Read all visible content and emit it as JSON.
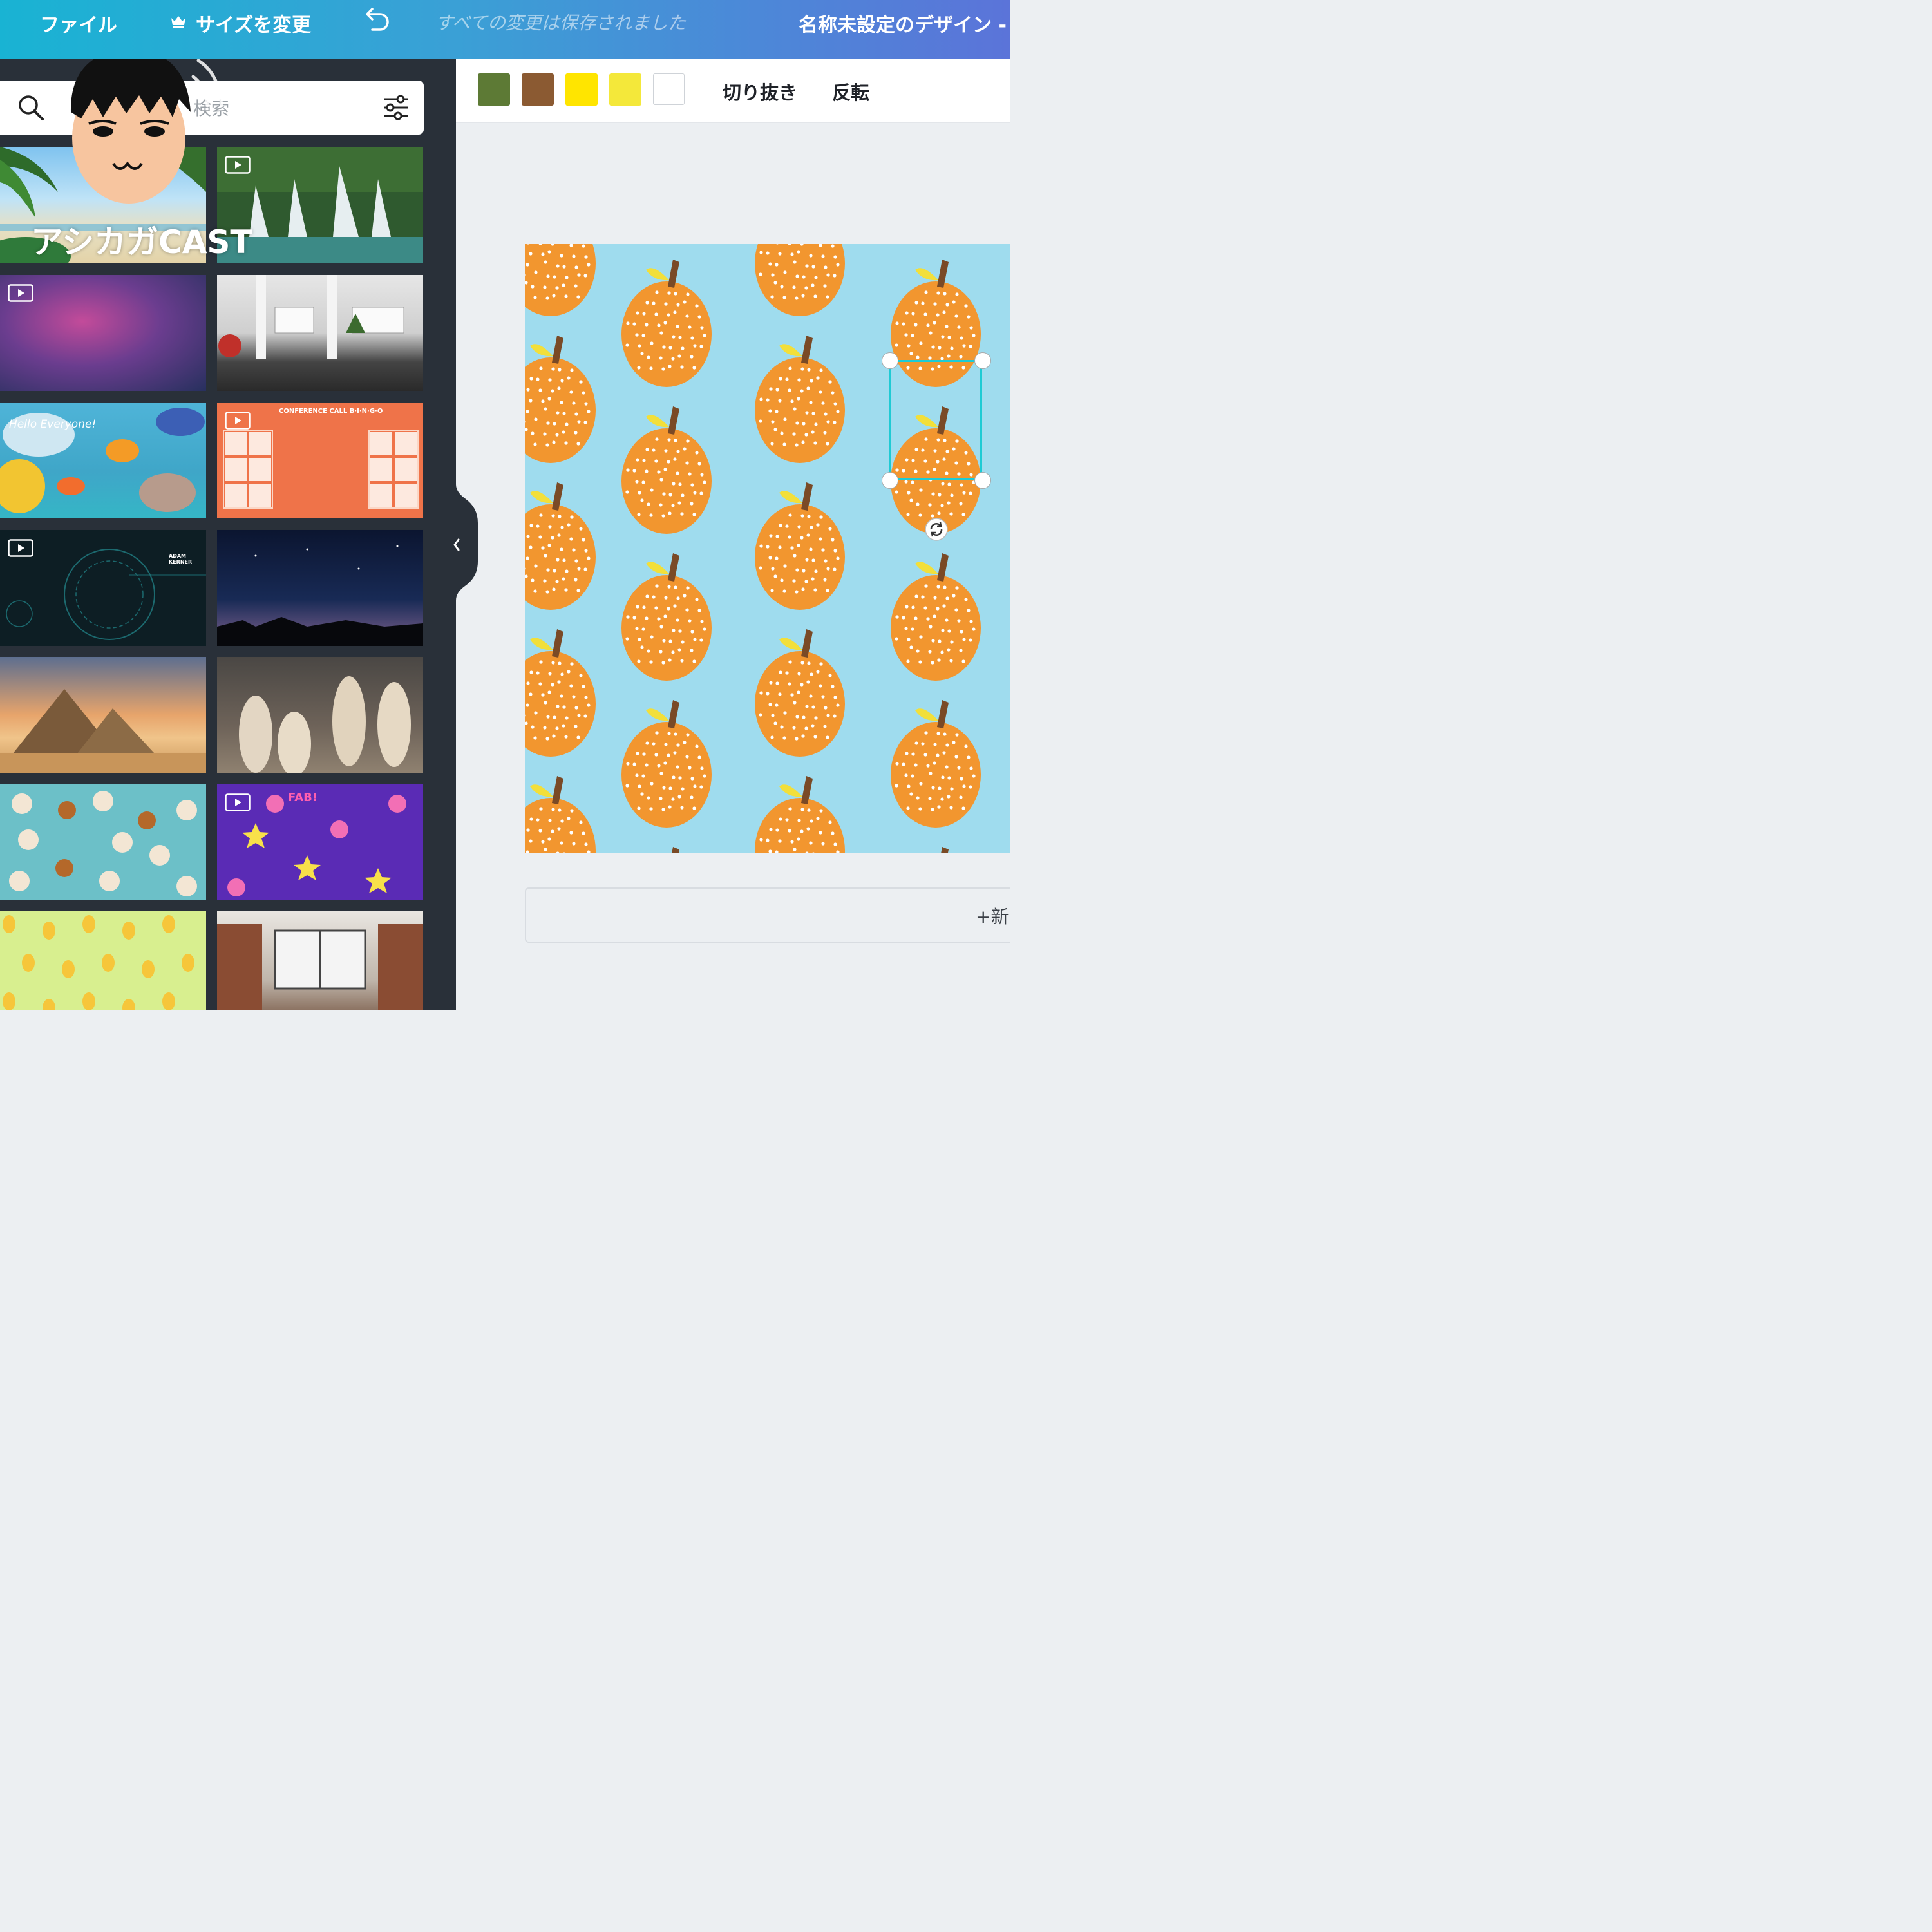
{
  "topbar": {
    "file_label": "ファイル",
    "resize_label": "サイズを変更",
    "save_status": "すべての変更は保存されました",
    "design_title": "名称未設定のデザイン - ..."
  },
  "sidebar": {
    "search_placeholder": "テンプレートを検索",
    "search_visible_suffix": "検索",
    "thumbnails": [
      {
        "name": "beach-palm",
        "video": false
      },
      {
        "name": "waterfall",
        "video": true
      },
      {
        "name": "purple-nebula",
        "video": true
      },
      {
        "name": "office-interior",
        "video": false
      },
      {
        "name": "ocean-fish-hello",
        "video": false,
        "caption": "Hello Everyone!"
      },
      {
        "name": "conference-call-bingo",
        "video": true,
        "caption": "CONFERENCE CALL B·I·N·G·O"
      },
      {
        "name": "tech-hud",
        "video": true,
        "caption": "ADAM KERNER"
      },
      {
        "name": "night-sky",
        "video": false
      },
      {
        "name": "pyramids",
        "video": false
      },
      {
        "name": "meerkats",
        "video": false
      },
      {
        "name": "dog-pattern",
        "video": false
      },
      {
        "name": "fab-stickers",
        "video": true,
        "caption": "FAB!"
      },
      {
        "name": "pear-pattern",
        "video": false
      },
      {
        "name": "brick-office",
        "video": false
      }
    ]
  },
  "toolbar": {
    "swatches": [
      "#5d7a35",
      "#8b5a32",
      "#ffe500",
      "#f4e83a",
      "#ffffff"
    ],
    "crop_label": "切り抜き",
    "flip_label": "反転"
  },
  "canvas": {
    "background_color": "#9fdcee",
    "fruit_color": "#f2962f",
    "selected_fruit_color": "#fde800",
    "add_page_label": "+新"
  },
  "overlay": {
    "brand_text": "アシカガCAST"
  }
}
